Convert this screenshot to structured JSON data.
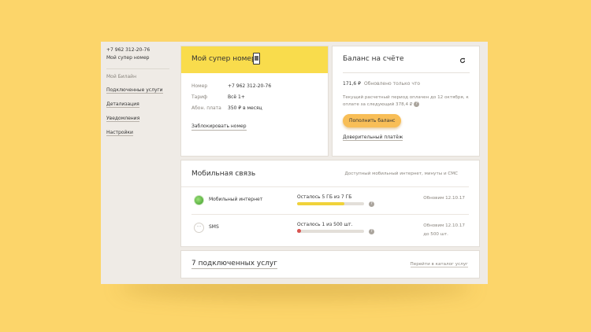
{
  "sidebar": {
    "phone": "+7 962 312-20-76",
    "name": "Мой супер номер",
    "section": "Мой Билайн",
    "items": [
      {
        "label": "Подключенные услуги"
      },
      {
        "label": "Детализация"
      },
      {
        "label": "Уведомления"
      },
      {
        "label": "Настройки"
      }
    ]
  },
  "number_card": {
    "title": "Мой супер номер",
    "rows": [
      {
        "key": "Номер",
        "value": "+7 962 312-20-76"
      },
      {
        "key": "Тариф",
        "value": "Всё 1+"
      },
      {
        "key": "Абон. плата",
        "value": "350 ₽ в месяц"
      }
    ],
    "block_link": "Заблокировать номер"
  },
  "balance_card": {
    "title": "Баланс на счёте",
    "amount": "171,6 ₽",
    "updated": "Обновлено только что",
    "note": "Текущий расчетный период оплачен до 12 октября, к оплате за следующий 378,4 ₽",
    "pay_button": "Пополнить баланс",
    "trust_link": "Доверительный платёж",
    "info_glyph": "?"
  },
  "mobile_card": {
    "title": "Мобильная связь",
    "subtitle": "Доступный мобильный интернет, минуты и СМС",
    "rows": [
      {
        "icon": "mobile-internet-icon",
        "name": "Мобильный интернет",
        "remaining": "Осталось 5 ГБ из 7 ГБ",
        "progress": 0.71,
        "updated_line1": "Обновим 12.10.17",
        "updated_line2": ""
      },
      {
        "icon": "sms-icon",
        "icon_glyph": "···",
        "name": "SMS",
        "remaining": "Осталось 1 из 500 шт.",
        "progress": 0.002,
        "updated_line1": "Обновим 12.10.17",
        "updated_line2": "до 500 шт."
      }
    ]
  },
  "services_card": {
    "title": "7 подключенных услуг",
    "catalog_link": "Перейти в каталог услуг"
  },
  "colors": {
    "background": "#fcd56a",
    "accent_yellow": "#f9dc4c",
    "button": "#f8be57",
    "progress_fill": "#f0d23a",
    "low_indicator": "#d9534f"
  }
}
